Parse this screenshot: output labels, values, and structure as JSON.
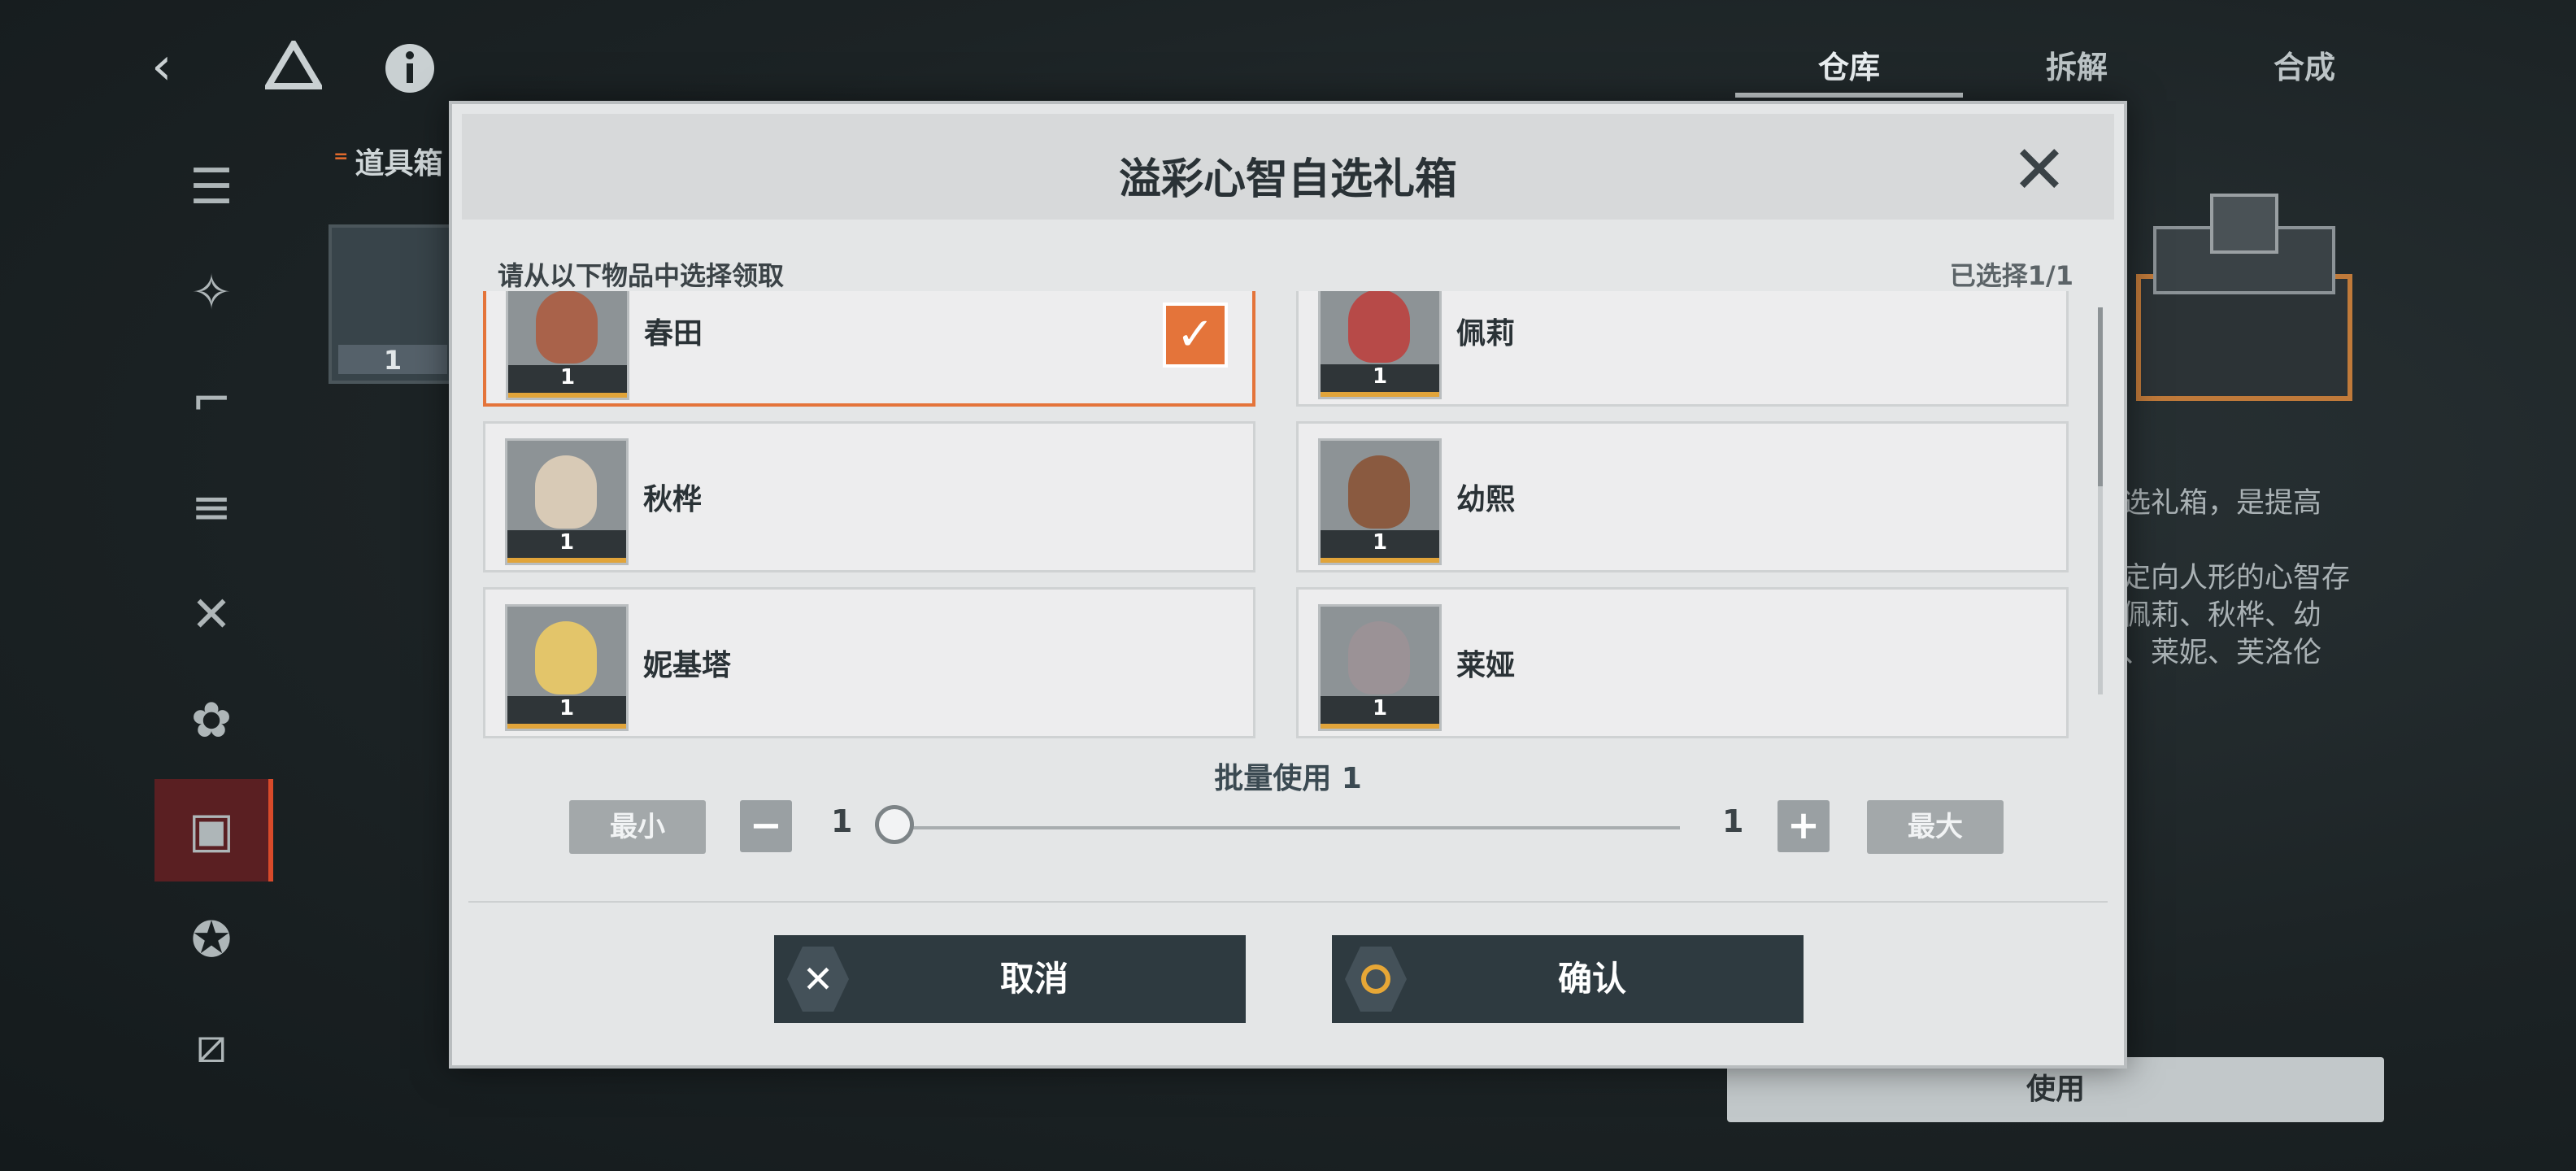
{
  "top_nav": {
    "back_icon": "chevron-left-icon",
    "logo_icon": "triangle-logo-icon",
    "info_icon": "info-icon",
    "tabs": [
      {
        "label": "仓库",
        "active": true
      },
      {
        "label": "拆解",
        "active": false
      },
      {
        "label": "合成",
        "active": false
      }
    ]
  },
  "sidebar": {
    "icons": [
      "stack-icon",
      "sparkle-icon",
      "gun-icon",
      "weapon-part-icon",
      "cross-blades-icon",
      "flower-icon",
      "box-icon",
      "star-icon",
      "slash-badge-icon"
    ],
    "active_index": 6
  },
  "background_panel": {
    "category_label": "道具箱",
    "item_count": "1",
    "description_lines": [
      "选礼箱，是提高",
      "",
      "定向人形的心智存",
      "佩莉、秋桦、幼",
      "、莱妮、芙洛伦"
    ],
    "use_button": "使用"
  },
  "dialog": {
    "title": "溢彩心智自选礼箱",
    "hint": "请从以下物品中选择领取",
    "selected_count": "已选择1/1",
    "items": [
      {
        "name": "春田",
        "count": "1",
        "selected": true,
        "hair": "#a9624a"
      },
      {
        "name": "佩莉",
        "count": "1",
        "selected": false,
        "hair": "#b74a48"
      },
      {
        "name": "秋桦",
        "count": "1",
        "selected": false,
        "hair": "#d8cab6"
      },
      {
        "name": "幼熙",
        "count": "1",
        "selected": false,
        "hair": "#8a5a40"
      },
      {
        "name": "妮基塔",
        "count": "1",
        "selected": false,
        "hair": "#e3c56a"
      },
      {
        "name": "莱娅",
        "count": "1",
        "selected": false,
        "hair": "#9b9296"
      }
    ],
    "batch": {
      "label": "批量使用 1",
      "min_label": "最小",
      "max_label": "最大",
      "current_value": "1",
      "max_value": "1"
    },
    "cancel_label": "取消",
    "confirm_label": "确认"
  },
  "colors": {
    "accent_orange": "#e4743a",
    "button_dark": "#2e3a40",
    "confirm_ring": "#e7a736"
  }
}
